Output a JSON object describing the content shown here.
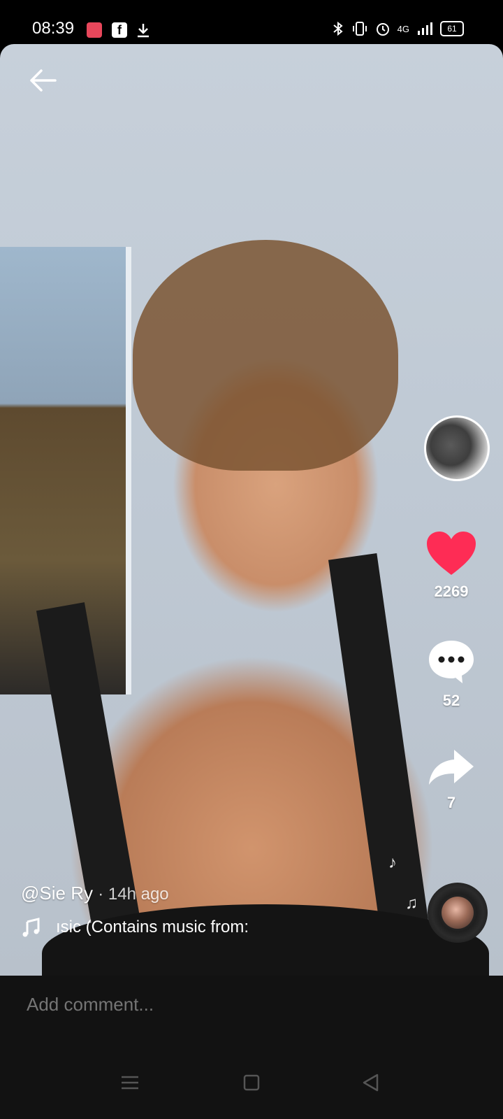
{
  "status_bar": {
    "time": "08:39",
    "network": "4G",
    "battery": "61"
  },
  "video": {
    "author": "@Sie Ry",
    "time_ago": "· 14h ago",
    "music_text": "ısic (Contains music from:"
  },
  "actions": {
    "likes": "2269",
    "comments": "52",
    "shares": "7",
    "like_color": "#fe2c55"
  },
  "comment_bar": {
    "placeholder": "Add comment..."
  },
  "icons": {
    "back": "back-arrow-icon",
    "like": "heart-icon",
    "comment": "comment-bubble-icon",
    "share": "share-arrow-icon",
    "music": "music-note-icon"
  }
}
